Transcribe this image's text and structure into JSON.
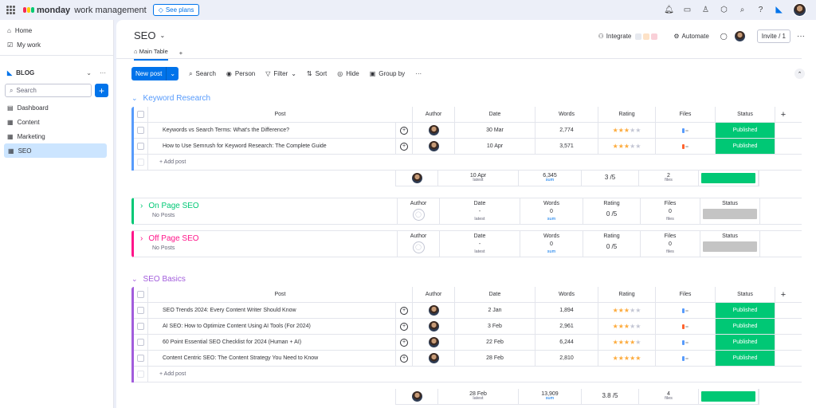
{
  "topbar": {
    "brand": "monday",
    "brand_sub": "work management",
    "see_plans": "See plans"
  },
  "sidebar": {
    "home": "Home",
    "my_work": "My work",
    "workspace": "BLOG",
    "search_placeholder": "Search",
    "boards": [
      "Dashboard",
      "Content",
      "Marketing",
      "SEO"
    ]
  },
  "board": {
    "title": "SEO",
    "integrate": "Integrate",
    "automate": "Automate",
    "invite": "Invite / 1",
    "tab_main": "Main Table",
    "tab_add": "+"
  },
  "toolbar": {
    "new_post": "New post",
    "search": "Search",
    "person": "Person",
    "filter": "Filter",
    "sort": "Sort",
    "hide": "Hide",
    "group_by": "Group by"
  },
  "columns": {
    "post": "Post",
    "author": "Author",
    "date": "Date",
    "words": "Words",
    "rating": "Rating",
    "files": "Files",
    "status": "Status"
  },
  "colors": {
    "published": "#00c875",
    "empty_status": "#c4c4c4",
    "keyword": "#579bfc",
    "onpage": "#00c875",
    "offpage": "#ff158a",
    "basics": "#a25ddc"
  },
  "groups": {
    "keyword": {
      "title": "Keyword Research",
      "rows": [
        {
          "post": "Keywords vs Search Terms: What's the Difference?",
          "date": "30 Mar",
          "words": "2,774",
          "rating": 3,
          "status": "Published"
        },
        {
          "post": "How to Use Semrush for Keyword Research: The Complete Guide",
          "date": "10 Apr",
          "words": "3,571",
          "rating": 3,
          "status": "Published"
        }
      ],
      "add_post": "+ Add post",
      "summary": {
        "date": "10 Apr",
        "date_sub": "latest",
        "words": "6,345",
        "words_sub": "sum",
        "rating": "3 /5",
        "files": "2",
        "files_sub": "files"
      }
    },
    "onpage": {
      "title": "On Page SEO",
      "no_posts": "No Posts",
      "summary": {
        "date": "-",
        "date_sub": "latest",
        "words": "0",
        "words_sub": "sum",
        "rating": "0 /5",
        "files": "0",
        "files_sub": "files"
      }
    },
    "offpage": {
      "title": "Off Page SEO",
      "no_posts": "No Posts",
      "summary": {
        "date": "-",
        "date_sub": "latest",
        "words": "0",
        "words_sub": "sum",
        "rating": "0 /5",
        "files": "0",
        "files_sub": "files"
      }
    },
    "basics": {
      "title": "SEO Basics",
      "rows": [
        {
          "post": "SEO Trends 2024: Every Content Writer Should Know",
          "date": "2 Jan",
          "words": "1,894",
          "rating": 3,
          "status": "Published"
        },
        {
          "post": "AI SEO: How to Optimize Content Using AI Tools (For 2024)",
          "date": "3 Feb",
          "words": "2,961",
          "rating": 3,
          "status": "Published"
        },
        {
          "post": "60 Point Essential SEO Checklist for 2024 (Human + AI)",
          "date": "22 Feb",
          "words": "6,244",
          "rating": 4,
          "status": "Published"
        },
        {
          "post": "Content Centric SEO: The Content Strategy You Need to Know",
          "date": "28 Feb",
          "words": "2,810",
          "rating": 5,
          "status": "Published"
        }
      ],
      "add_post": "+ Add post",
      "summary": {
        "date": "28 Feb",
        "date_sub": "latest",
        "words": "13,909",
        "words_sub": "sum",
        "rating": "3.8 /5",
        "files": "4",
        "files_sub": "files"
      }
    }
  }
}
